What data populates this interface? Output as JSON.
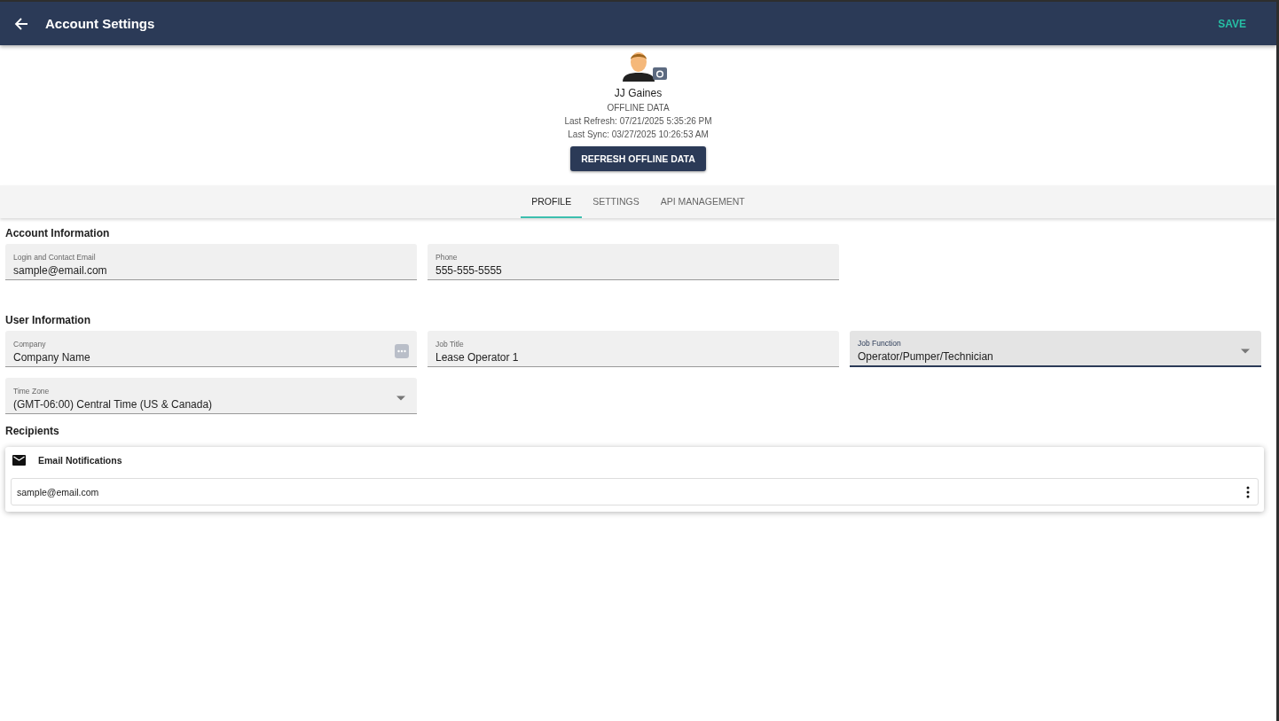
{
  "app_bar": {
    "title": "Account Settings",
    "action": "SAVE"
  },
  "profile": {
    "name": "JJ Gaines",
    "status": "OFFLINE DATA",
    "last_refresh": "Last Refresh: 07/21/2025 5:35:26 PM",
    "last_sync": "Last Sync: 03/27/2025 10:26:53 AM",
    "button": "REFRESH OFFLINE DATA"
  },
  "tabs": [
    {
      "label": "PROFILE",
      "selected": true
    },
    {
      "label": "SETTINGS",
      "selected": false
    },
    {
      "label": "API MANAGEMENT",
      "selected": false
    }
  ],
  "sections": [
    {
      "title": "Account Information",
      "rows": [
        [
          {
            "kind": "text",
            "label": "Login and Contact Email",
            "value": "sample@email.com",
            "focused": false
          },
          {
            "kind": "text",
            "label": "Phone",
            "value": "555-555-5555",
            "focused": false
          }
        ]
      ]
    },
    {
      "title": "User Information",
      "rows": [
        [
          {
            "kind": "lookup",
            "label": "Company",
            "value": "Company Name",
            "focused": false
          },
          {
            "kind": "text",
            "label": "Job Title",
            "value": "Lease Operator 1",
            "focused": false
          },
          {
            "kind": "select",
            "label": "Job Function",
            "value": "Operator/Pumper/Technician",
            "focused": true
          }
        ],
        [
          {
            "kind": "select",
            "label": "Time Zone",
            "value": "(GMT-06:00) Central Time (US & Canada)",
            "focused": false
          }
        ]
      ]
    }
  ],
  "recipients": {
    "title": "Recipients",
    "card_title": "Email Notifications",
    "items": [
      "sample@email.com"
    ]
  }
}
